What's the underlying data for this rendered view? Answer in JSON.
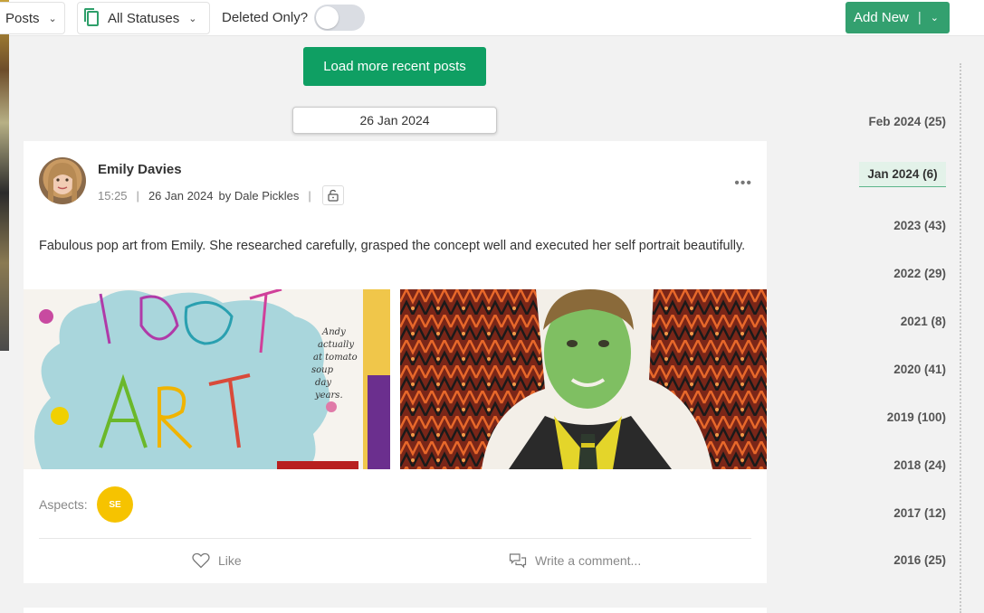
{
  "toolbar": {
    "posts_dropdown": "Posts",
    "status_dropdown": "All Statuses",
    "deleted_only_label": "Deleted Only?",
    "deleted_only_on": false,
    "add_new_label": "Add New"
  },
  "feed": {
    "load_more_label": "Load more recent posts",
    "date_marker": "26 Jan 2024"
  },
  "post": {
    "author": "Emily Davies",
    "time": "15:25",
    "date": "26 Jan 2024",
    "by": "by Dale Pickles",
    "text": "Fabulous pop art from Emily. She researched carefully, grasped the concept well and executed her self portrait beautifully.",
    "images": [
      {
        "icon": "pop-art-drawing"
      },
      {
        "icon": "self-portrait-collage"
      }
    ],
    "aspects_label": "Aspects:",
    "aspect_badge": "SE",
    "like_label": "Like",
    "comment_placeholder": "Write a comment..."
  },
  "timeline": [
    {
      "label": "Feb 2024 (25)",
      "active": false
    },
    {
      "label": "Jan 2024 (6)",
      "active": true
    },
    {
      "label": "2023 (43)",
      "active": false
    },
    {
      "label": "2022 (29)",
      "active": false
    },
    {
      "label": "2021 (8)",
      "active": false
    },
    {
      "label": "2020 (41)",
      "active": false
    },
    {
      "label": "2019 (100)",
      "active": false
    },
    {
      "label": "2018 (24)",
      "active": false
    },
    {
      "label": "2017 (12)",
      "active": false
    },
    {
      "label": "2016 (25)",
      "active": false
    }
  ],
  "colors": {
    "primary_green": "#33a06f",
    "load_more_green": "#0f9f63",
    "aspect_badge": "#f6c300",
    "timeline_active_bg": "#e3f2e9"
  }
}
